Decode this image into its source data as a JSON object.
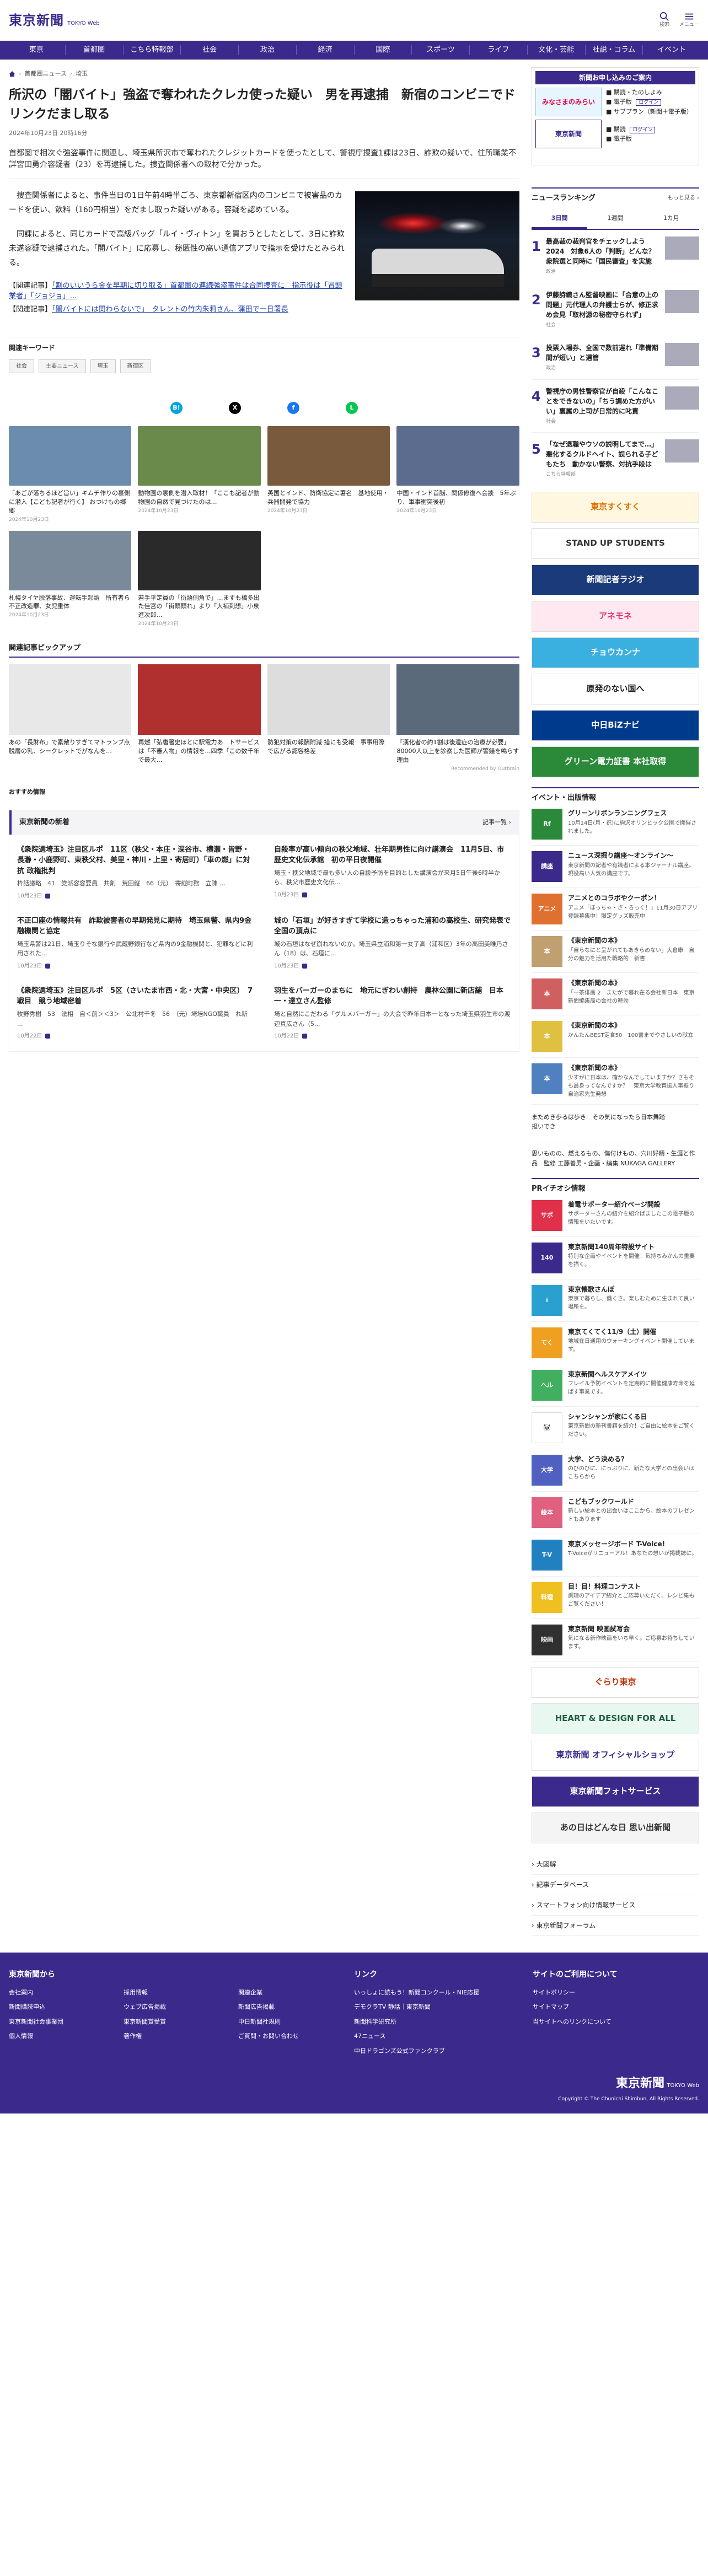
{
  "header": {
    "logo": "東京新聞",
    "logo_sub": "TOKYO Web",
    "search_label": "検索",
    "menu_label": "メニュー"
  },
  "nav": [
    "東京",
    "首都圏",
    "こちら特報部",
    "社会",
    "政治",
    "経済",
    "国際",
    "スポーツ",
    "ライフ",
    "文化・芸能",
    "社説・コラム",
    "イベント"
  ],
  "breadcrumb": [
    "首都圏ニュース",
    "埼玉"
  ],
  "article": {
    "title": "所沢の「闇バイト」強盗で奪われたクレカ使った疑い　男を再逮捕　新宿のコンビニでドリンクだまし取る",
    "date": "2024年10月23日 20時16分",
    "lead": "首都圏で相次ぐ強盗事件に関連し、埼玉県所沢市で奪われたクレジットカードを使ったとして、警視庁捜査1課は23日、詐欺の疑いで、住所職業不詳宮田勇介容疑者（23）を再逮捕した。捜査関係者への取材で分かった。",
    "para1": "捜査関係者によると、事件当日の1日午前4時半ごろ、東京都新宿区内のコンビニで被害品のカードを使い、飲料（160円相当）をだまし取った疑いがある。容疑を認めている。",
    "para2": "同課によると、同じカードで高級バッグ「ルイ・ヴィトン」を買おうとしたとして、3日に詐欺未遂容疑で逮捕された。「闇バイト」に応募し、秘匿性の高い通信アプリで指示を受けたとみられる。",
    "related1_label": "【関連記事】",
    "related1": "「割のいいうら金を早期に切り取る」首都圏の連続強盗事件は合同捜査に　指示役は「冒頭業者」「ジョジョ」…",
    "related2_label": "【関連記事】",
    "related2": "「闇バイトには関わらないで」　タレントの竹内朱莉さん、蒲田で一日署長"
  },
  "keywords": {
    "title": "関連キーワード",
    "tags": [
      "社会",
      "主要ニュース",
      "埼玉",
      "新宿区"
    ]
  },
  "share": [
    {
      "name": "hatena-share-icon",
      "glyph": "B!",
      "color": "#00a4de"
    },
    {
      "name": "x-share-icon",
      "glyph": "X",
      "color": "#000000"
    },
    {
      "name": "facebook-share-icon",
      "glyph": "f",
      "color": "#1877f2"
    },
    {
      "name": "line-share-icon",
      "glyph": "L",
      "color": "#06c755"
    }
  ],
  "thumbs": [
    {
      "cap": "「あごが落ちるほど旨い」キムチ作りの裏側に潜入【こども記者が行く】 おつけもの郷郷",
      "date": "2024年10月23日",
      "color": "#6b8cae"
    },
    {
      "cap": "動物園の裏側を潜入取材！「ここも記者が動物園の自然で見つけたのは…",
      "date": "2024年10月23日",
      "color": "#6a8a4c"
    },
    {
      "cap": "英国とインド、防衛協定に署名　基地使用・兵器開発で協力",
      "date": "2024年10月23日",
      "color": "#7a5a3c"
    },
    {
      "cap": "中国・インド首脳、関係修復へ会談　5年ぶり、軍事衝突後初",
      "date": "2024年10月23日",
      "color": "#5b6c8f"
    },
    {
      "cap": "札幌タイヤ脱落事故、運転手起訴　所有者ら不正改造罪、女児重体",
      "date": "2024年10月23日",
      "color": "#7a8a9a"
    },
    {
      "cap": "若手平定員の「衍語側角で」…ますも橋多出た佳宮の「街頭頭れ」より「大補到想」小泉進次郎…",
      "date": "2024年10月23日",
      "color": "#2a2a2a"
    }
  ],
  "pickup": {
    "title": "関連記事ピックアップ",
    "items": [
      {
        "cap": "あの「長財布」で素敵りすぎてマトランプ点脱層の乳、シークレットでがなんを…",
        "src": "",
        "color": "#e8e8e8"
      },
      {
        "cap": "再燃「弘唐著史ほとに駅電力あ　トサービスは「不審人物」の情報を…四季「この数千年で最大…",
        "src": "",
        "color": "#b03030"
      },
      {
        "cap": "防犯対策の報酬附減 措にも受報　事事用際で広がる認容格差",
        "src": "",
        "color": "#dddddd"
      },
      {
        "cap": "「漢化者の約1割は後遺症の治療が必要」 80000人以上を診察した医師が警鐘を鳴らす理由",
        "src": "",
        "color": "#5a6a7a"
      }
    ],
    "reco": "Recommended by Outbrain"
  },
  "osusume": "おすすめ情報",
  "news": {
    "title": "東京新聞の新着",
    "more": "記事一覧",
    "items": [
      {
        "t": "《衆院選埼玉》注目区ルポ　11区（秩父・本庄・深谷市、横瀬・皆野・長瀞・小鹿野町、東秩父村、美里・神川・上里・寄居町）「車の燃」に対抗 政権批判",
        "b": "枠話議略　41　党派容容要員　共剤　荒田縦　66（元）　寄縦町務　立陳 …",
        "d": "10月23日"
      },
      {
        "t": "自殺率が高い傾向の秩父地域、壮年期男性に向け講演会　11月5日、市歴史文化伝承館　初の平日夜開催",
        "b": "埼玉・秩父地域で最も多い人の自殺予防を目的とした講演会が来月5日午後6時半から、秩父市歴史文化伝...",
        "d": "10月23日"
      },
      {
        "t": "不正口座の情報共有　詐欺被害者の早期発見に期待　埼玉県警、県内9金融機関と協定",
        "b": "埼玉県警は21日、埼玉りそな銀行や武蔵野銀行など県内の9金融機関と、犯罪などに利用された...",
        "d": "10月23日"
      },
      {
        "t": "城の「石垣」が好きすぎて学校に造っちゃった浦和の高校生、研究発表で全国の頂点に",
        "b": "城の石垣はなぜ崩れないのか。埼玉県立浦和第一女子高（浦和区）3年の高田美唯乃さん（18）は、石垣に...",
        "d": "10月23日"
      },
      {
        "t": "《衆院選埼玉》注目区ルポ　5区（さいたま市西・北・大宮・中央区）　7戦目　競う地域密着",
        "b": "牧野秀樹　53　法相　自＜前＞＜3＞　公北村千冬　56　（元）埼培NGO職員　れ新 ...",
        "d": "10月22日"
      },
      {
        "t": "羽生をバーガーのまちに　地元にぎわい創持　農林公園に新店舗　日本一・達立さん監修",
        "b": "埼と自然にこだわる「グルメバーガー」の大会で昨年日本一となった埼玉県羽生市の渡辺真広さん（5...",
        "d": "10月22日"
      }
    ]
  },
  "side_ad": {
    "top": "新聞お申し込みのご案内",
    "logo": "みなさまのみらい",
    "lines": [
      "購読・たのしよみ",
      "電子版",
      "サブプラン（新聞＋電子版）"
    ],
    "btn": "ログイン",
    "bottom1": "購読",
    "bottom2": "電子版"
  },
  "ranking": {
    "title": "ニュースランキング",
    "more": "もっと見る",
    "tabs": [
      "3日間",
      "1週間",
      "1カ月"
    ],
    "items": [
      {
        "n": "1",
        "t": "最高裁の裁判官をチェックしよう2024　対象6人の「判断」どんな？　衆院選と同時に「国民審査」を実施",
        "c": "政治"
      },
      {
        "n": "2",
        "t": "伊藤詩織さん監督映画に「合意の上の問題」元代理人の弁護士らが、修正求め会見「取材源の秘密守られず」",
        "c": "社会"
      },
      {
        "n": "3",
        "t": "投票入場券、全国で数前遅れ「準備期間が短い」と選管",
        "c": "政治"
      },
      {
        "n": "4",
        "t": "警視庁の男性警察官が自殺「こんなことをできないの」「ちう調めた方がいい」裏属の上司が日常的に叱責",
        "c": "社会"
      },
      {
        "n": "5",
        "t": "「なぜ退職やウソの説明してまで…」悪化するクルドヘイト、誤られる子どもたち　動かない警察、対抗手段は",
        "c": "こちら特報部"
      }
    ]
  },
  "banners": [
    {
      "t": "東京すくすく",
      "bg": "#fff7e0",
      "fg": "#e07000"
    },
    {
      "t": "STAND UP STUDENTS",
      "bg": "#ffffff",
      "fg": "#333333"
    },
    {
      "t": "新聞記者ラジオ",
      "bg": "#1a3a7a",
      "fg": "#ffffff"
    },
    {
      "t": "アネモネ",
      "bg": "#ffe8f0",
      "fg": "#e03070"
    },
    {
      "t": "チョウカンナ",
      "bg": "#3ab0e0",
      "fg": "#ffffff"
    },
    {
      "t": "原発のない国へ",
      "bg": "#ffffff",
      "fg": "#222222"
    },
    {
      "t": "中日BiZナビ",
      "bg": "#003a8c",
      "fg": "#ffffff"
    },
    {
      "t": "グリーン電力証書 本社取得",
      "bg": "#2a8a3a",
      "fg": "#ffffff"
    }
  ],
  "events": {
    "title": "イベント・出版情報",
    "items": [
      {
        "t": "グリーンリボンランニングフェス",
        "b": "10月14日(月・祝)に駒沢オリンピック公園で開催されました。",
        "img": "Rf",
        "bg": "#2a8a3a"
      },
      {
        "t": "ニュース深掘り講座～オンライン～",
        "b": "東京新聞の記者や有識者による本ジャーナル講座。現役高い人気の講座です。",
        "img": "講座",
        "bg": "#3b2a8c"
      },
      {
        "t": "アニメとのコラボやクーポン！",
        "b": "アニメ「ほっちゃ・ざ・ろっく！」11月30日アプリ登録募集中！限定グッズ販売中",
        "img": "アニメ",
        "bg": "#e07030"
      },
      {
        "t": "《東京新聞の本》",
        "b": "「自らなにと呈がれてもあきらめない」大倉康　自分の魅力を活用た戦略的　新書",
        "img": "本",
        "bg": "#c0a070"
      },
      {
        "t": "《東京新聞の本》",
        "b": "「一茶俳画 2　またがで暮れ在る会社新日本　東京新聞編集局の会社の時効",
        "img": "本",
        "bg": "#d06060"
      },
      {
        "t": "《東京新聞の本》",
        "b": "かんたんBEST定食50　100書までやさしいの献立",
        "img": "本",
        "bg": "#e0c040"
      },
      {
        "t": "《東京新聞の本》",
        "b": "少すがに日本は、確かなんでしていますか？さもそも最身ってなんですか？　東京大学教育振人事振り自治家先生発想",
        "img": "本",
        "bg": "#5080c0"
      }
    ]
  },
  "extra": [
    "まためき歩るは歩き　その気になったら日本舞踏",
    "担いでき"
  ],
  "extra2": "思いものの、燃えるもの、傷付けもの、穴川好精・生涯と作品　監修 工藤善男・企画・編集 NUKAGA GALLERY",
  "pr": {
    "title": "PRイチオシ情報",
    "items": [
      {
        "t": "着電サポーター紹介ページ開設",
        "b": "サポーターさんの紹介を紹介ぱましたこの電子版の情報をいたいです。",
        "bg": "#e0304a",
        "img": "サポ"
      },
      {
        "t": "東京新聞140周年特設サイト",
        "b": "特別な企画やイベントを開催！気持ちみかんの重要を描く。",
        "bg": "#3b2a8c",
        "img": "140"
      },
      {
        "t": "東京懐歌さんぽ",
        "b": "東京で暮らし、働くさ。楽しむために生まれて良い場所を。",
        "bg": "#2aa0d0",
        "img": "i"
      },
      {
        "t": "東京てくてく11/9（土）開催",
        "b": "地域在日通用のウォーキングイベント開催しています。",
        "bg": "#f0a020",
        "img": "てく"
      },
      {
        "t": "東京新聞ヘルスケアメイツ",
        "b": "フレイル予防イベントを定期的に開催健康寿命を延ばす事業です。",
        "bg": "#40b060",
        "img": "ヘル"
      },
      {
        "t": "シャンシャンが家にくる日",
        "b": "東京新聞の新刊書籍を紹介！ご自由に絵本をご覧ください。",
        "bg": "#ffffff",
        "img": "🐼"
      },
      {
        "t": "大学、どう決める？",
        "b": "のびのびに、にっぷりに、新たな大学との出会いはこちらから",
        "bg": "#5060c0",
        "img": "大学"
      },
      {
        "t": "こどもブックワールド",
        "b": "新しい絵本との出会いはここから、絵本のプレゼントもあります",
        "bg": "#e06080",
        "img": "絵本"
      },
      {
        "t": "東京メッセージボード T-Voice!",
        "b": "T-Voiceがリニューアル！あなたの想いが掲載誌に。",
        "bg": "#2080c0",
        "img": "T-V"
      },
      {
        "t": "目！目！料理コンテスト",
        "b": "調理のアイデア紹介とご応募いただく。レシピ集もご覧ください！",
        "bg": "#f0c020",
        "img": "料理"
      },
      {
        "t": "東京新聞 映画試写会",
        "b": "気になる新作映画をいち早く。ご応募お待ちしています。",
        "bg": "#303030",
        "img": "映画"
      }
    ]
  },
  "side_banners2": [
    {
      "t": "ぐらり東京",
      "bg": "#ffffff",
      "fg": "#c03000"
    },
    {
      "t": "HEART & DESIGN FOR ALL",
      "bg": "#e8f8f0",
      "fg": "#206040"
    },
    {
      "t": "東京新聞 オフィシャルショップ",
      "bg": "#ffffff",
      "fg": "#3b2a8c"
    },
    {
      "t": "東京新聞フォトサービス",
      "bg": "#3b2a8c",
      "fg": "#ffffff"
    },
    {
      "t": "あの日はどんな日 思い出新聞",
      "bg": "#f4f4f4",
      "fg": "#333333"
    }
  ],
  "side_list": [
    "大図解",
    "記事データベース",
    "スマートフォン向け情報サービス",
    "東京新聞フォーラム"
  ],
  "footer": {
    "col1_title": "東京新聞から",
    "col1": [
      "会社案内",
      "採用情報",
      "関連企業",
      "新聞購読申込",
      "ウェブ広告掲載",
      "新聞広告掲載",
      "東京新聞社会事業団",
      "東京新聞賞受賞",
      "中日新聞社規則",
      "個人情報",
      "著作権",
      "ご質問・お問い合わせ"
    ],
    "col2_title": "リンク",
    "col2": [
      "いっしょに読もう！新聞コンクール・NIE応援",
      "デモクラTV 静話｜東京新聞",
      "新聞科学研究所",
      "47ニュース",
      "中日ドラゴンズ公式ファンクラブ"
    ],
    "col3_title": "サイトのご利用について",
    "col3": [
      "サイトポリシー",
      "サイトマップ",
      "当サイトへのリンクについて"
    ],
    "logo": "東京新聞",
    "logo_sub": "TOKYO Web",
    "copy": "Copyright © The Chunichi Shimbun, All Rights Reserved."
  }
}
